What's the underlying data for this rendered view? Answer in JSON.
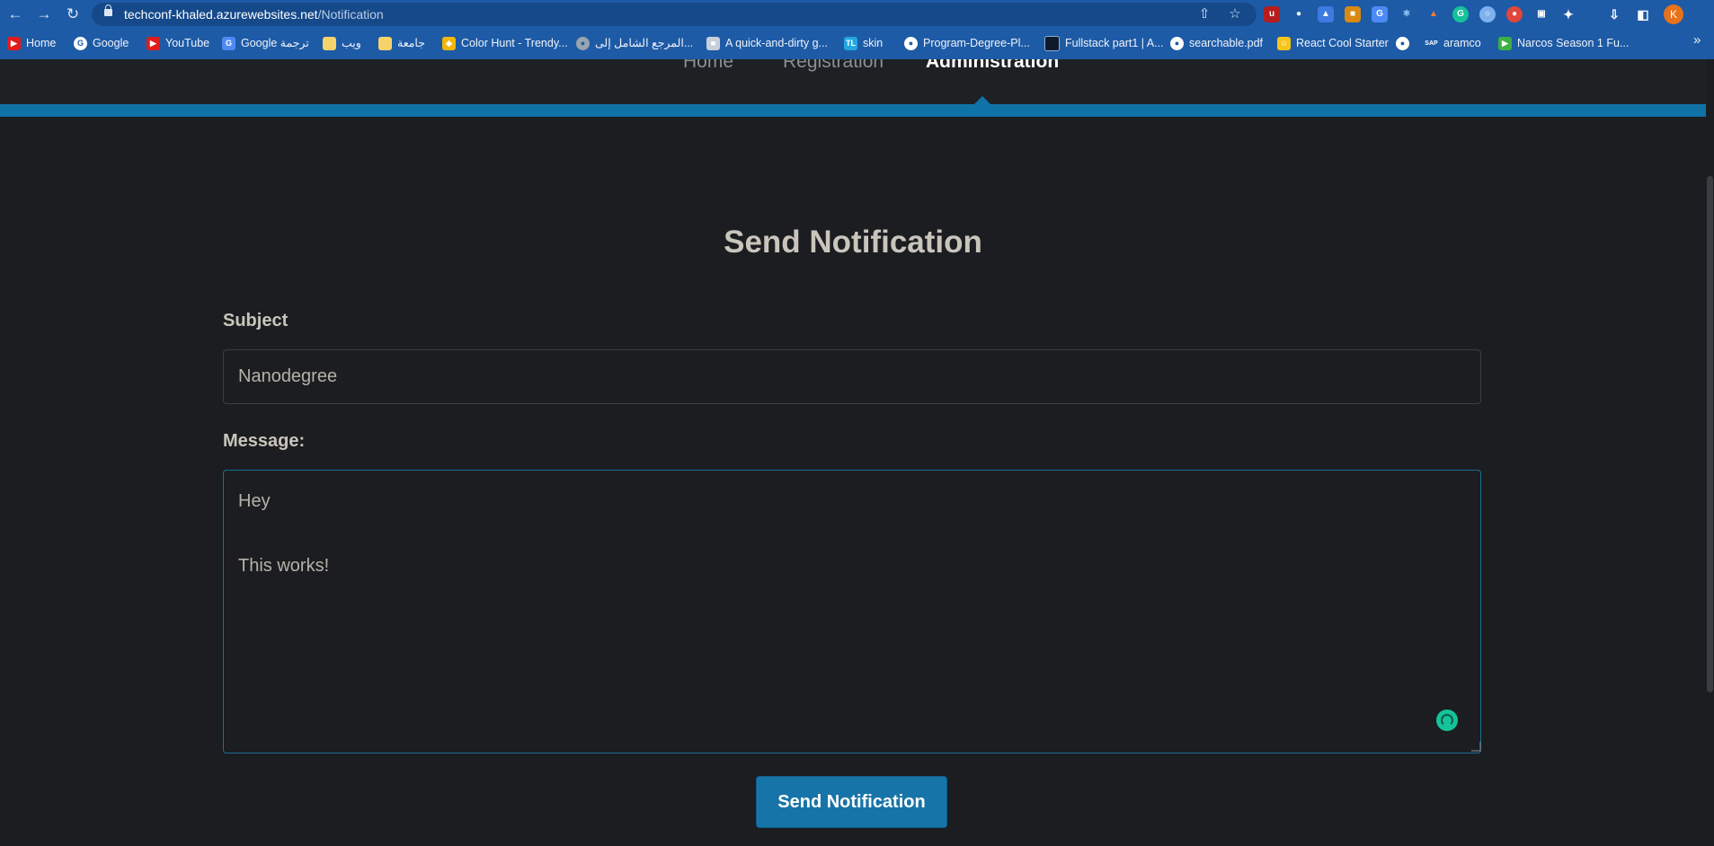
{
  "browser": {
    "url_host": "techconf-khaled.azurewebsites.net",
    "url_path": "/Notification",
    "profile_initial": "K",
    "bookmarks": [
      {
        "label": "Home",
        "icon": "youtube-icon",
        "color": "#e21b1b"
      },
      {
        "label": "Google",
        "icon": "google-icon",
        "color": "#ffffff"
      },
      {
        "label": "YouTube",
        "icon": "youtube-icon",
        "color": "#e21b1b"
      },
      {
        "label": "Google ترجمة",
        "icon": "translate-icon",
        "color": "#4c8bf5"
      },
      {
        "label": "ويب",
        "icon": "folder-icon",
        "color": "#f6d36b"
      },
      {
        "label": "جامعة",
        "icon": "folder-icon",
        "color": "#f6d36b"
      },
      {
        "label": "Color Hunt - Trendy...",
        "icon": "colorhunt-icon",
        "color": "#f2b705"
      },
      {
        "label": "المرجع الشامل إلى...",
        "icon": "globe-icon",
        "color": "#9aa4ae"
      },
      {
        "label": "A quick-and-dirty g...",
        "icon": "doc-icon",
        "color": "#c7d0da"
      },
      {
        "label": "skin",
        "icon": "tl-icon",
        "color": "#22a7e3"
      },
      {
        "label": "Program-Degree-Pl...",
        "icon": "globe-icon",
        "color": "#ffffff"
      },
      {
        "label": "Fullstack part1 | A...",
        "icon": "square-icon",
        "color": "#0e1a2b"
      },
      {
        "label": "searchable.pdf",
        "icon": "globe-icon",
        "color": "#ffffff"
      },
      {
        "label": "React Cool Starter",
        "icon": "emoji-icon",
        "color": "#f5c518"
      },
      {
        "label": "",
        "icon": "globe-icon",
        "color": "#ffffff"
      },
      {
        "label": "aramco",
        "icon": "sap-icon",
        "color": "#1e5ba6"
      },
      {
        "label": "Narcos Season 1 Fu...",
        "icon": "play-icon",
        "color": "#3cb043"
      }
    ]
  },
  "site_nav": {
    "items": [
      {
        "label": "Home",
        "active": false
      },
      {
        "label": "Registration",
        "active": false
      },
      {
        "label": "Administration",
        "active": true
      }
    ]
  },
  "form": {
    "title": "Send Notification",
    "subject_label": "Subject",
    "subject_value": "Nanodegree",
    "message_label": "Message:",
    "message_lines": [
      "Hey",
      "",
      "This works!"
    ],
    "submit_label": "Send Notification"
  }
}
